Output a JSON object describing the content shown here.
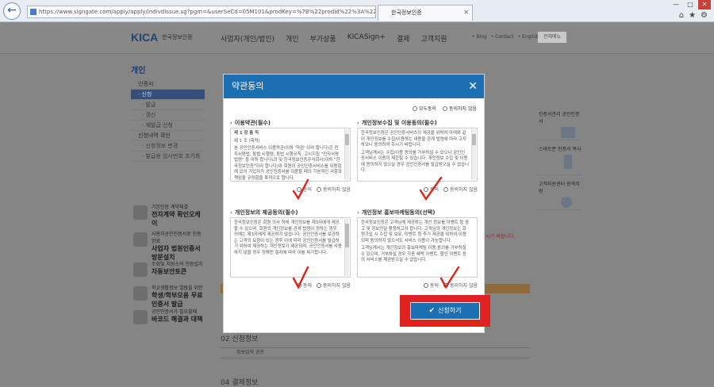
{
  "browser": {
    "url": "https://www.signgate.com/apply/apply/indivdIssue.sg?pgm=&userSeCd=05M101&prodKey=%7B%22prodId%22%3A%2234def3",
    "tab_title": "한국정보인증",
    "back_icon": "arrow-left-icon",
    "window_controls": [
      "—",
      "□",
      "✕"
    ],
    "toolbar_icons": [
      "⌂",
      "★",
      "⚙"
    ]
  },
  "site": {
    "logo": "KICA",
    "logo_sub": "한국정보인증",
    "gnb": [
      "사업자(개인/법인)",
      "개인",
      "부가상품",
      "KICASign+",
      "결제",
      "고객지원"
    ],
    "util": [
      "• Blog",
      "• Contact",
      "• English"
    ],
    "menu_button": "전체메뉴"
  },
  "lnb": {
    "title": "개인",
    "items": [
      {
        "label": "인증서",
        "type": "main"
      },
      {
        "label": "· 신청",
        "type": "active"
      },
      {
        "label": "· 발급",
        "type": "sub"
      },
      {
        "label": "· 갱신",
        "type": "sub"
      },
      {
        "label": "· 재발급 신청",
        "type": "sub"
      },
      {
        "label": "신청내역 확인",
        "type": "main"
      },
      {
        "label": "· 신청정보 변경",
        "type": "sub"
      },
      {
        "label": "· 발급용 임시번호 조기화",
        "type": "sub"
      }
    ],
    "promos": [
      {
        "small": "기본인증 계약체결",
        "bold": "전자계약 확인오케이"
      },
      {
        "small": "사용자공인인증서로 인증 완료",
        "bold": "사업자 법원인증서 방문설치"
      },
      {
        "small": "조회및 저장소의 인증설치",
        "bold": "자동보안토큰"
      },
      {
        "small": "학교생활정보 열람을 위한",
        "bold": "학생/학부모용 무료인증서 발급"
      },
      {
        "small": "공인인증서가 필요할때",
        "bold": "바코드 해결과 대책"
      }
    ]
  },
  "quick": [
    {
      "label": "인증서관리 공인인증서"
    },
    {
      "label": "스마트폰 인증서 복사"
    },
    {
      "label": "고객지원센터 원격지원"
    }
  ],
  "page": {
    "red_note": "※ 주시기 바랍니다.",
    "section_02": "02 신청정보",
    "section_02_row": "정보입력 공프",
    "section_04": "04 결제정보"
  },
  "modal": {
    "title": "약관동의",
    "all_agree": "모두동의",
    "all_disagree": "동의하지 않음",
    "agree_label": "동의",
    "disagree_label": "동의하지 않음",
    "terms": [
      {
        "title": "이용약관(필수)",
        "body": [
          "제 1 장 총 칙",
          "제 1 조 (목적)",
          "본 공인인증서비스 이용약관(이하 '약관' 이라 합니다)은 전자서명법, 동법 시행령, 동법 시행규칙, 고시지침 \"전자서명법령\" 등 이하 합니다)과 및 한국정보인증주식회사(이하 \"한국정보인증\"이라 합니다)와 회원이 공인인증서비스를 이용함에 있어 가입자가 공인인증서를 이용할 때의 기본적인 사항과 책임을 규정함을 목적으로 합니다."
        ]
      },
      {
        "title": "개인정보수집 및 이용동의(필수)",
        "body": [
          "한국정보인증은 공인인증서비스의 제공을 위하여 아래와 같이 개인정보를 수집/이용하는 내용을 관계 법령에 따라 고지하오니 동의하여 주시기 바랍니다.",
          "고객님께서는 수집/이용 동의를 거부하실 수 있으나 공인인증서비스 이용이 제한될 수 있습니다. 개인정보 수집 및 이용에 동의하지 않으실 경우 공인인증서를 발급받으실 수 없습니다."
        ]
      },
      {
        "title": "개인정보의 제공동의(필수)",
        "body": [
          "한국정보인증은 회원 의사 하에 개인정보를 제3자에게 제공할 수 있으며, 회원의 개인정보를 관계 법령이 정하는 경우 외에는 제3자에게 제공하지 않습니다. 공인인증서를 보관하는 고객의 요청이 있는 경우 이에 따라 공인인증서를 발급하기 위하여 제공하는 개인정보가 제공되며, 공인인증서를 사용하지 않을 경우 정해진 절차에 따라 이를 파기합니다."
        ]
      },
      {
        "title": "개인정보 홍보마케팅동의(선택)",
        "body": [
          "한국정보인증은 고객님께 제공하는 개인 정보를 이벤트 등 광고 및 정보전달 활용하고자 합니다. 고객님의 개인정보는 회원가입 시 수집 및 보유, 이벤트 등 추가 제공을 위하여 이용되며 동의하지 않으셔도 서비스 이용이 가능합니다.",
          "고객님께서는 개인정보의 홍보마케팅 이용 동의를 거부하실 수 있으며, 거부하실 경우 각종 혜택 이벤트, 할인 이벤트 등의 서비스를 제공받으실 수 없습니다."
        ]
      }
    ],
    "apply_button": "신청하기"
  },
  "colors": {
    "header_blue": "#1c6fb3",
    "highlight_red": "#e02320",
    "check_red": "#d9261c"
  }
}
